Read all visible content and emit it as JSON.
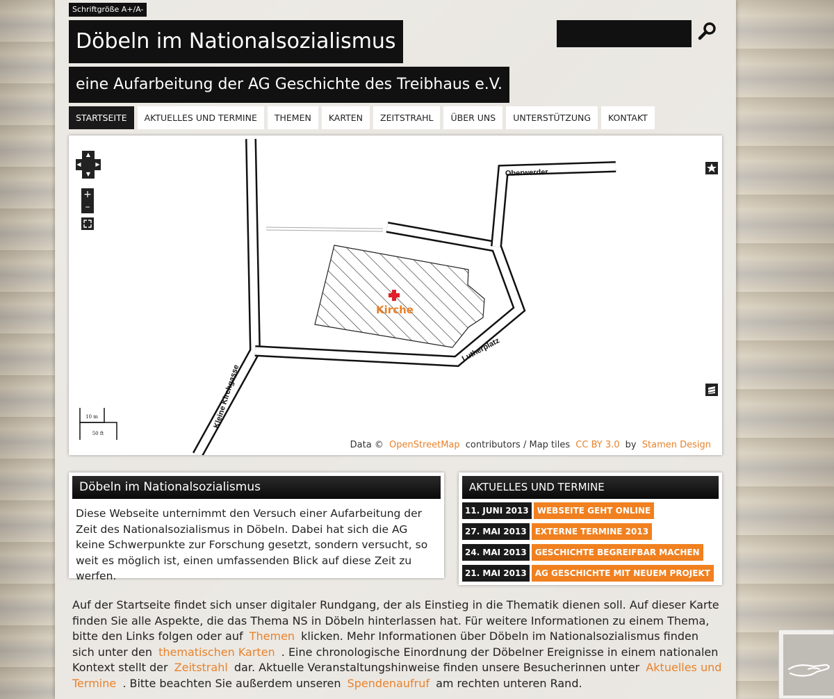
{
  "header": {
    "fontsize_label": "Schriftgröße A+/A-",
    "title": "Döbeln im Nationalsozialismus",
    "subtitle": "eine Aufarbeitung der AG Geschichte des Treibhaus e.V.",
    "search_value": ""
  },
  "nav": {
    "items": [
      {
        "label": "Startseite",
        "active": true
      },
      {
        "label": "Aktuelles und Termine",
        "active": false
      },
      {
        "label": "Themen",
        "active": false
      },
      {
        "label": "Karten",
        "active": false
      },
      {
        "label": "Zeitstrahl",
        "active": false
      },
      {
        "label": "Über uns",
        "active": false
      },
      {
        "label": "Unterstützung",
        "active": false
      },
      {
        "label": "Kontakt",
        "active": false
      }
    ]
  },
  "map": {
    "street_labels": [
      "Oberwerder",
      "Lutherplatz",
      "Kleine Kirchgasse"
    ],
    "marker_label": "Kirche",
    "scale_metric": "10 m",
    "scale_imperial": "50 ft",
    "zoom_in": "+",
    "zoom_out": "–",
    "attribution": {
      "prefix": "Data ©",
      "osm_link": "OpenStreetMap",
      "middle": "contributors / Map tiles",
      "license_link": "CC BY 3.0",
      "by": "by",
      "tiles_link": "Stamen Design"
    },
    "accent_color": "#e8822b"
  },
  "intro": {
    "heading": "Döbeln im Nationalsozialismus",
    "text": "Diese Webseite unternimmt den Versuch einer Aufarbeitung der Zeit des Nationalsozialismus in Döbeln. Dabei hat sich die AG keine Schwerpunkte zur Forschung gesetzt, sondern versucht, so weit es möglich ist, einen umfassenden Blick auf diese Zeit zu werfen."
  },
  "news": {
    "heading": "AKTUELLES UND TERMINE",
    "items": [
      {
        "date": "11. JUNI 2013",
        "title": "Webseite geht online"
      },
      {
        "date": "27. MAI 2013",
        "title": "Externe Termine 2013"
      },
      {
        "date": "24. MAI 2013",
        "title": "Geschichte begreifbar machen"
      },
      {
        "date": "21. MAI 2013",
        "title": "AG Geschichte mit neuem Projekt"
      }
    ]
  },
  "body": {
    "p1": "Auf der Startseite findet sich unser digitaler Rundgang, der als Einstieg in die Thematik dienen soll. Auf dieser Karte finden Sie alle Aspekte, die das Thema NS in Döbeln hinterlassen hat. Für weitere Informationen zu einem Thema, bitte den Links folgen oder auf",
    "link_themen": "Themen",
    "p2": "klicken. Mehr Informationen über Döbeln im Nationalsozialismus finden sich unter den",
    "link_karten": "thematischen Karten",
    "p3": ". Eine chronologische Einordnung der Döbelner Ereignisse in einem nationalen Kontext stellt der",
    "link_zeitstrahl": "Zeitstrahl",
    "p4": "dar. Aktuelle Veranstaltungshinweise finden unsere Besucherinnen unter",
    "link_aktuelles": "Aktuelles und Termine",
    "p5": ". Bitte beachten Sie außerdem unseren",
    "link_spenden": "Spendenaufruf",
    "p6": "am rechten unteren Rand."
  },
  "colors": {
    "accent": "#f08020",
    "link": "#e8822b",
    "dark": "#111111",
    "marker": "#e0202a"
  }
}
